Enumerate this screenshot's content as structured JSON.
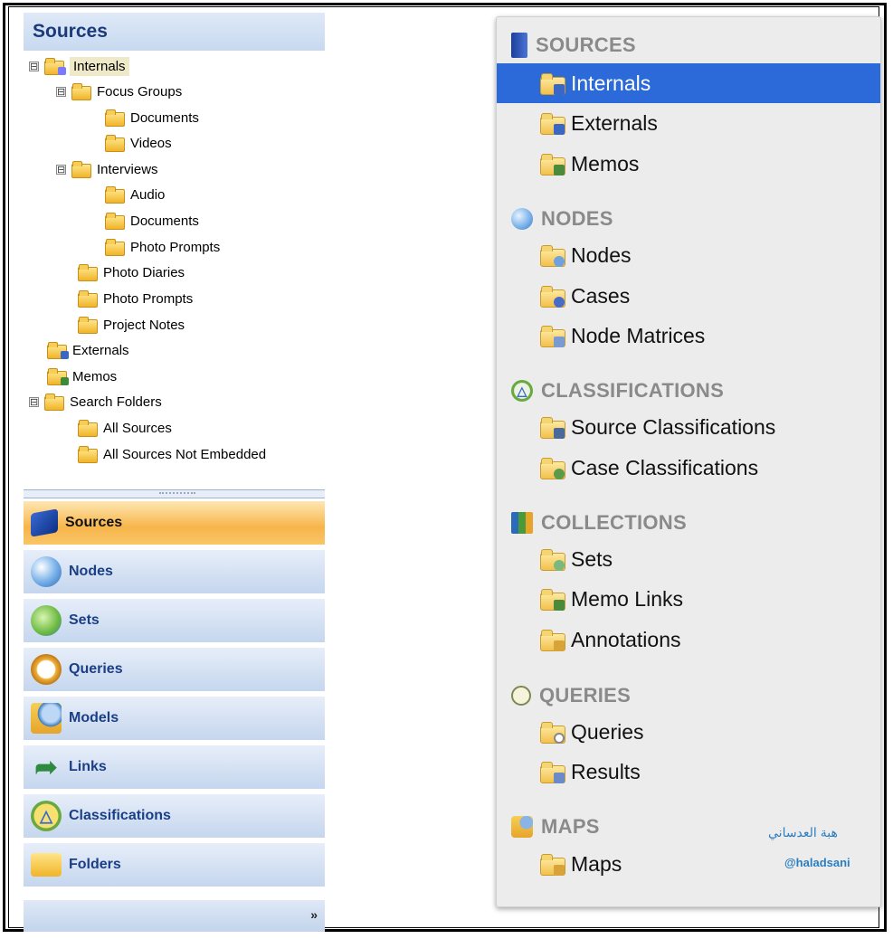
{
  "left_panel": {
    "header": "Sources",
    "tree": [
      {
        "label": "Internals",
        "expander": "⊟"
      },
      {
        "label": "Focus Groups",
        "expander": "⊟"
      },
      {
        "label": "Documents"
      },
      {
        "label": "Videos"
      },
      {
        "label": "Interviews",
        "expander": "⊟"
      },
      {
        "label": "Audio"
      },
      {
        "label": "Documents"
      },
      {
        "label": "Photo Prompts"
      },
      {
        "label": "Photo Diaries"
      },
      {
        "label": "Photo Prompts"
      },
      {
        "label": "Project Notes"
      },
      {
        "label": "Externals"
      },
      {
        "label": "Memos"
      },
      {
        "label": "Search Folders",
        "expander": "⊟"
      },
      {
        "label": "All Sources"
      },
      {
        "label": "All Sources Not Embedded"
      }
    ],
    "nav": [
      {
        "label": "Sources",
        "icon": "book-icon",
        "active": true
      },
      {
        "label": "Nodes",
        "icon": "sphere-icon"
      },
      {
        "label": "Sets",
        "icon": "sets-icon"
      },
      {
        "label": "Queries",
        "icon": "magnifier-icon"
      },
      {
        "label": "Models",
        "icon": "models-icon"
      },
      {
        "label": "Links",
        "icon": "arrow-icon"
      },
      {
        "label": "Classifications",
        "icon": "triangle-icon"
      },
      {
        "label": "Folders",
        "icon": "folder-icon"
      }
    ],
    "footer_chevron": "»"
  },
  "right_panel": {
    "sections": [
      {
        "title": "SOURCES",
        "icon": "book-icon",
        "items": [
          {
            "label": "Internals",
            "selected": true,
            "badge": "#3a66c4"
          },
          {
            "label": "Externals",
            "badge": "#3a66c4"
          },
          {
            "label": "Memos",
            "badge": "#4a8a3a"
          }
        ]
      },
      {
        "title": "NODES",
        "icon": "sphere-icon",
        "items": [
          {
            "label": "Nodes",
            "badge": "#6fa2dd"
          },
          {
            "label": "Cases",
            "badge": "#4a6ac8"
          },
          {
            "label": "Node Matrices",
            "badge": "#7a9ad0"
          }
        ]
      },
      {
        "title": "CLASSIFICATIONS",
        "icon": "triangle-icon",
        "items": [
          {
            "label": "Source Classifications",
            "badge": "#4a6a9a"
          },
          {
            "label": "Case Classifications",
            "badge": "#5a9a4a"
          }
        ]
      },
      {
        "title": "COLLECTIONS",
        "icon": "collections-icon",
        "items": [
          {
            "label": "Sets",
            "badge": "#7bb87b"
          },
          {
            "label": "Memo Links",
            "badge": "#4a8a3a"
          },
          {
            "label": "Annotations",
            "badge": "#d8a43a"
          }
        ]
      },
      {
        "title": "QUERIES",
        "icon": "magnifier-icon",
        "items": [
          {
            "label": "Queries",
            "badge": "#aaaaaa"
          },
          {
            "label": "Results",
            "badge": "#6a8ac8"
          }
        ]
      },
      {
        "title": "MAPS",
        "icon": "maps-icon",
        "items": [
          {
            "label": "Maps",
            "badge": "#d8a43a"
          }
        ]
      }
    ],
    "watermark_arabic": "هبة العدساني",
    "watermark_handle": "@haladsani"
  },
  "colors": {
    "accent_blue": "#2b6ad8",
    "nav_active": "#f7b54a",
    "left_text": "#1a3f86"
  }
}
